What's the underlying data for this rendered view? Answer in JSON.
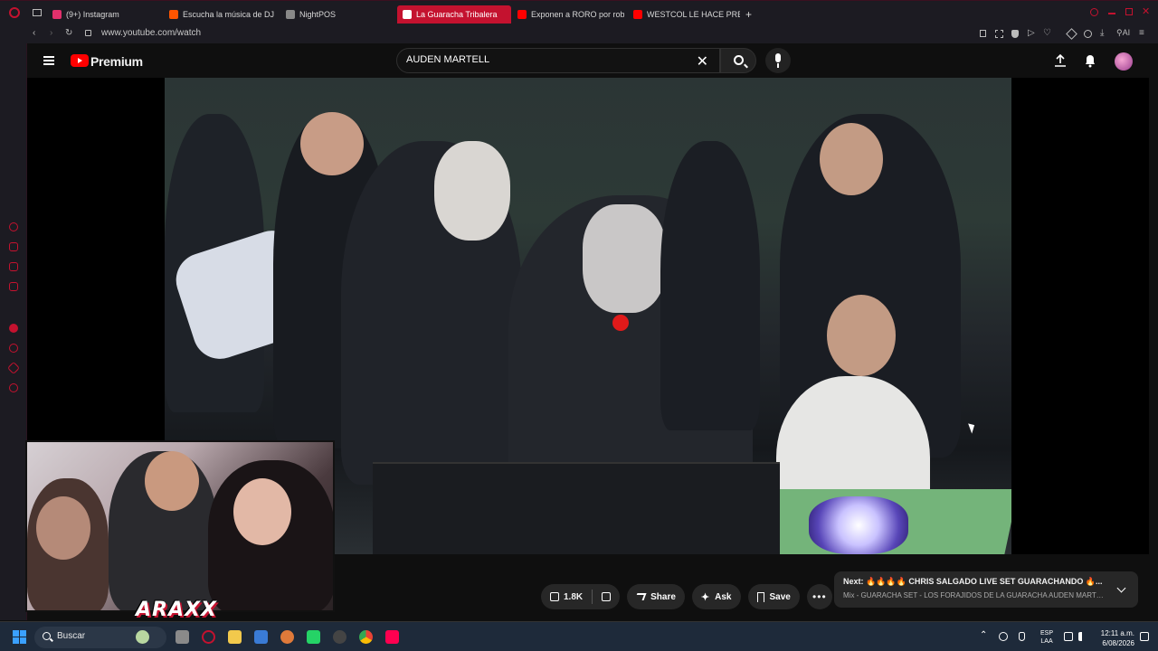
{
  "browser": {
    "tabs": [
      {
        "label": "(9+) Instagram",
        "color": "#e1306c"
      },
      {
        "label": "Escucha la música de DJ A",
        "color": "#ff5500"
      },
      {
        "label": "NightPOS",
        "color": "#888888"
      },
      {
        "label": "La Guaracha Tribalera",
        "color": "#ff0000",
        "active": true
      },
      {
        "label": "Exponen a RORO por roba",
        "color": "#ff0000"
      },
      {
        "label": "WESTCOL LE HACE PREGU",
        "color": "#ff0000"
      }
    ],
    "new_tab_label": "+",
    "url": "www.youtube.com/watch"
  },
  "youtube": {
    "brand": "Premium",
    "search_value": "AUDEN MARTELL",
    "search_clear": "✕"
  },
  "actions": {
    "like_count": "1.8K",
    "share_label": "Share",
    "ask_label": "Ask",
    "save_label": "Save",
    "more_label": "•••"
  },
  "next": {
    "title": "Next: 🔥🔥🔥🔥 CHRIS SALGADO LIVE SET GUARACHANDO 🔥...",
    "subtitle": "Mix - GUARACHA SET - LOS FORAJIDOS DE LA GUARACHA AUDEN MARTELL & ..."
  },
  "overlay": {
    "logo_text": "ARAXX"
  },
  "taskbar": {
    "search_label": "Buscar",
    "lang_line1": "ESP",
    "lang_line2": "LAA",
    "time": "12:11 a.m.",
    "date": "6/08/2026"
  },
  "colors": {
    "accent": "#c4122f",
    "yt_red": "#ff0000"
  }
}
